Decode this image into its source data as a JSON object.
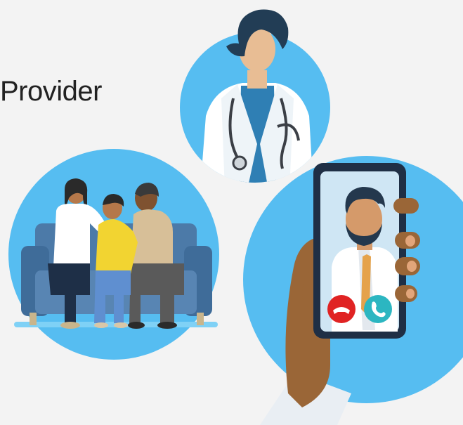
{
  "slide": {
    "title_fragment": "Provider"
  },
  "illustrations": {
    "doctor": "doctor-illustration",
    "family": "family-on-couch-illustration",
    "phone_call": "video-call-phone-illustration"
  },
  "colors": {
    "background": "#f3f3f3",
    "circle_blue": "#56bdf1",
    "decline": "#e02323",
    "accept": "#2cb6c1",
    "skin_tan": "#e8bd94",
    "hand_brown": "#9a6637",
    "navy": "#1f3a52"
  }
}
